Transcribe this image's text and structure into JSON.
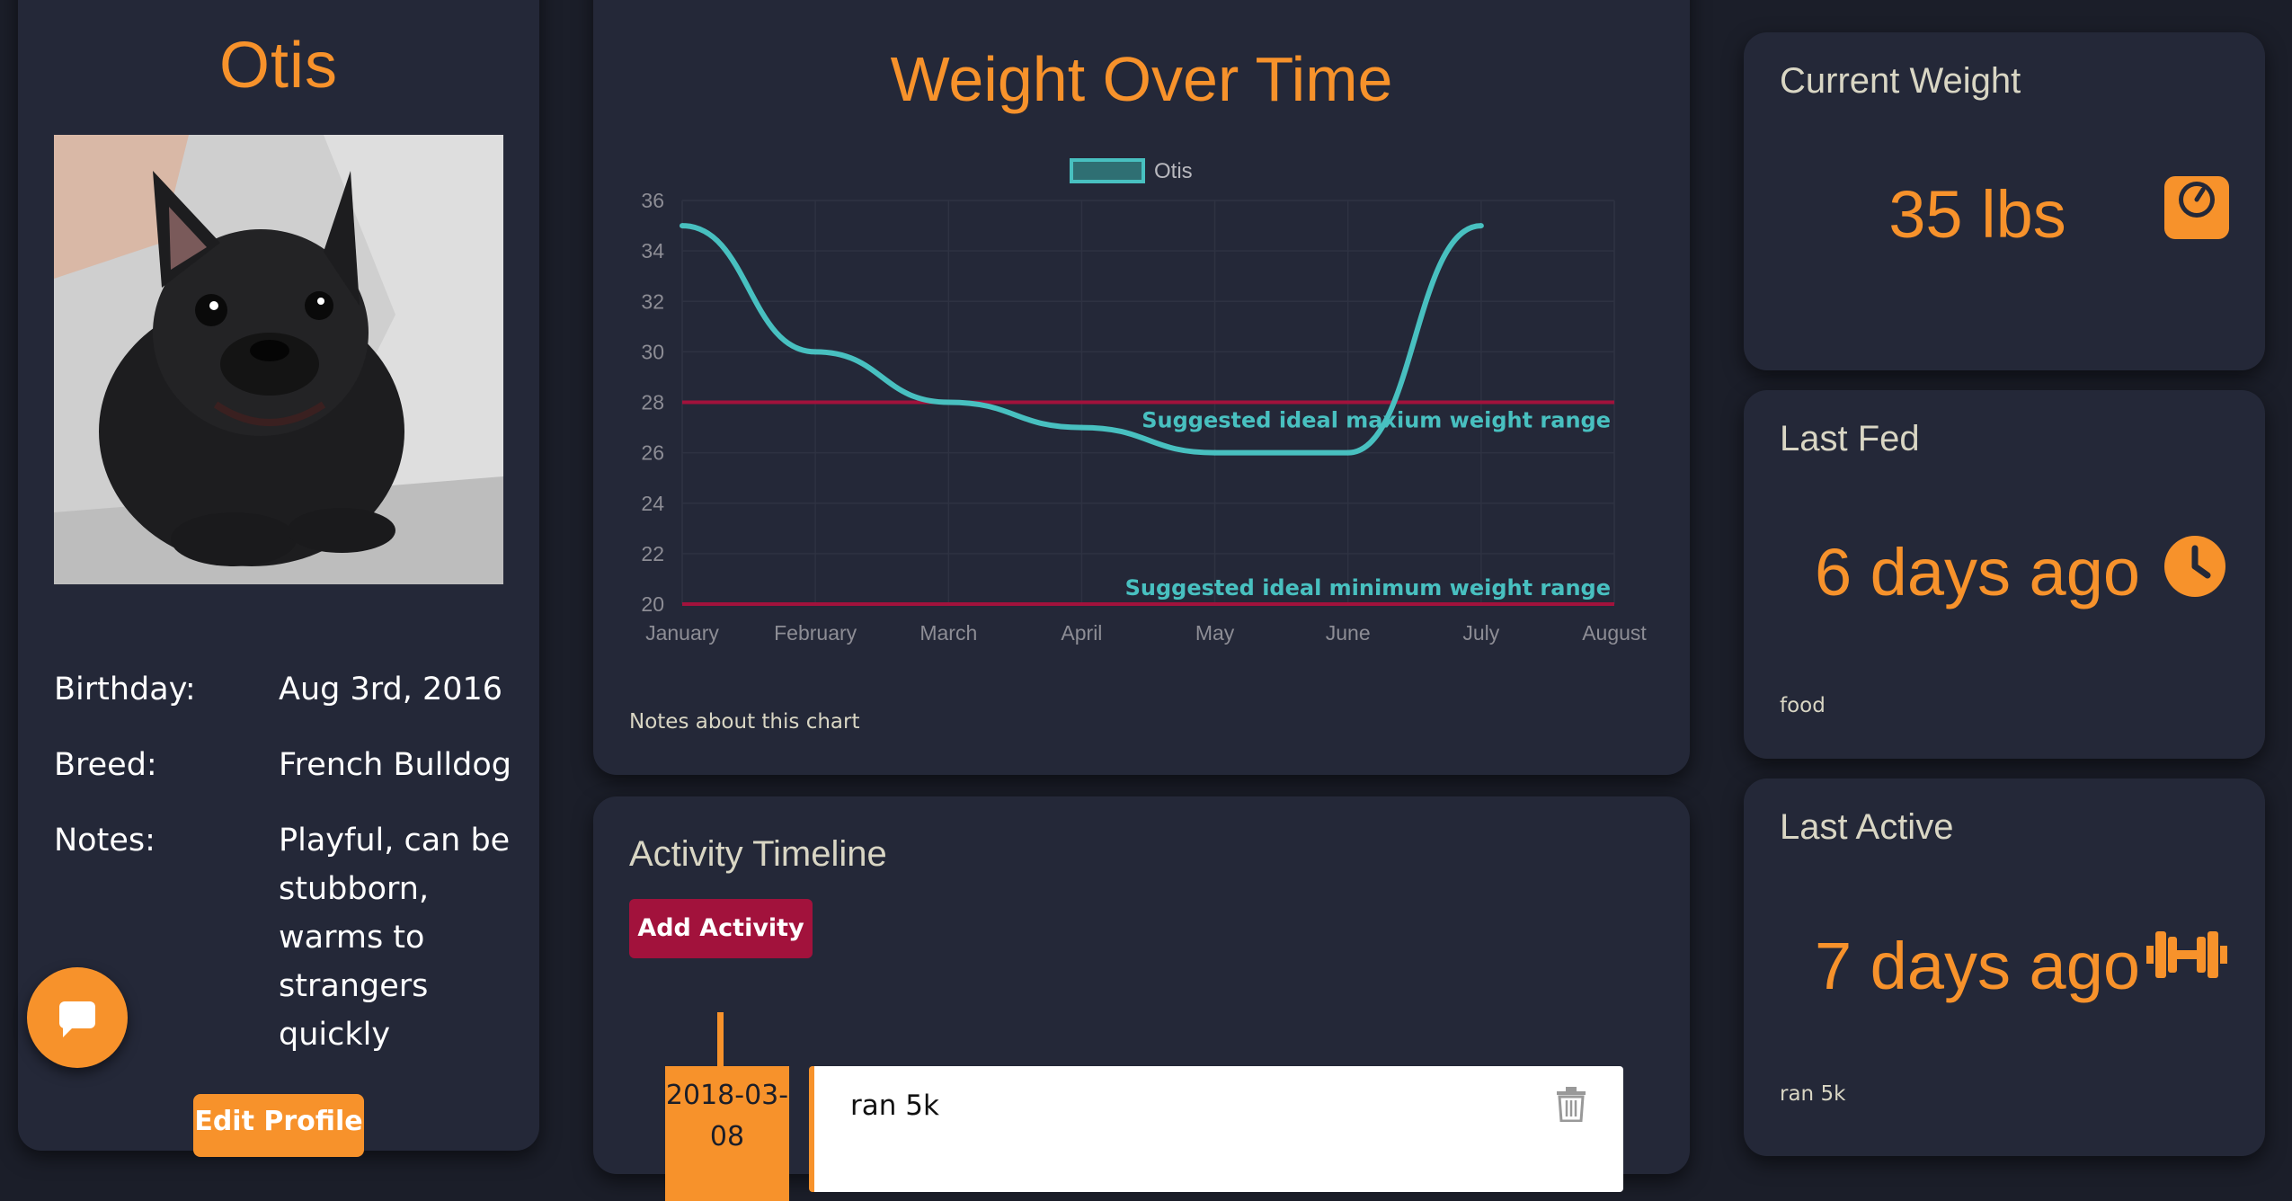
{
  "profile": {
    "name": "Otis",
    "photo_alt": "black french bulldog",
    "fields": [
      {
        "label": "Birthday:",
        "value": "Aug 3rd, 2016"
      },
      {
        "label": "Breed:",
        "value": "French Bulldog"
      },
      {
        "label": "Notes:",
        "value": "Playful, can be stubborn, warms to strangers quickly"
      }
    ],
    "edit_label": "Edit Profile"
  },
  "chat": {
    "icon": "chat-bubble-icon"
  },
  "weight_chart": {
    "title": "Weight Over Time",
    "notes": "Notes about this chart"
  },
  "chart_data": {
    "type": "line",
    "title": "Weight Over Time",
    "categories": [
      "January",
      "February",
      "March",
      "April",
      "May",
      "June",
      "July",
      "August"
    ],
    "series": [
      {
        "name": "Otis",
        "values": [
          35,
          30,
          28,
          27,
          26,
          26,
          35,
          null
        ],
        "color": "#48c0c0"
      }
    ],
    "reference_lines": [
      {
        "label": "Suggested ideal maxium weight range",
        "value": 28,
        "color": "#a2123c"
      },
      {
        "label": "Suggested ideal minimum weight range",
        "value": 20,
        "color": "#a2123c"
      }
    ],
    "yticks": [
      20,
      22,
      24,
      26,
      28,
      30,
      32,
      34,
      36
    ],
    "ylim": [
      20,
      36
    ],
    "legend": "top-center",
    "grid": true
  },
  "activity": {
    "title": "Activity Timeline",
    "add_label": "Add Activity",
    "items": [
      {
        "date": "2018-03-08",
        "label": "ran 5k",
        "trash_icon": "trash-icon"
      }
    ]
  },
  "stats": {
    "weight": {
      "title": "Current Weight",
      "value": "35 lbs",
      "icon": "scale-icon"
    },
    "fed": {
      "title": "Last Fed",
      "value": "6 days ago",
      "icon": "clock-icon",
      "note": "food"
    },
    "active": {
      "title": "Last Active",
      "value": "7 days ago",
      "icon": "dumbbell-icon",
      "note": "ran 5k"
    }
  },
  "colors": {
    "accent": "#f7922b",
    "card": "#242838",
    "background": "#1b1e29",
    "line": "#48c0c0",
    "danger": "#a2123c"
  }
}
